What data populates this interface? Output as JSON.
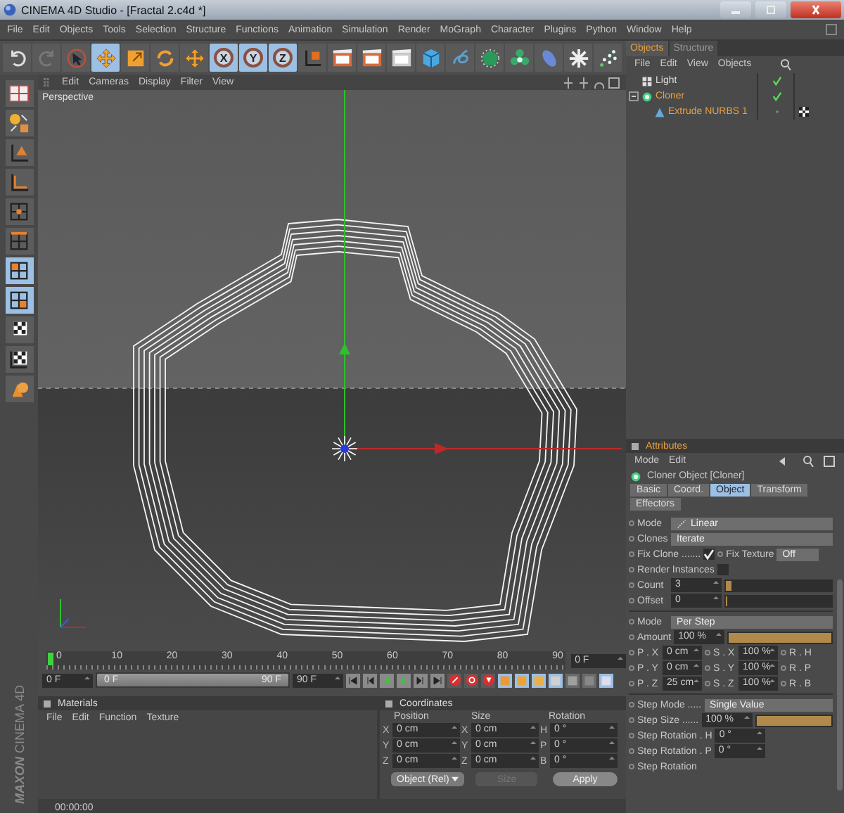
{
  "window": {
    "title": "CINEMA 4D Studio - [Fractal 2.c4d *]"
  },
  "menu": [
    "File",
    "Edit",
    "Objects",
    "Tools",
    "Selection",
    "Structure",
    "Functions",
    "Animation",
    "Simulation",
    "Render",
    "MoGraph",
    "Character",
    "Plugins",
    "Python",
    "Window",
    "Help"
  ],
  "toolbar": [
    {
      "kind": "undo",
      "selected": false
    },
    {
      "kind": "redo",
      "selected": false
    },
    {
      "kind": "select",
      "selected": false
    },
    {
      "kind": "move",
      "selected": true
    },
    {
      "kind": "scale",
      "selected": false
    },
    {
      "kind": "rotate",
      "selected": false
    },
    {
      "kind": "add",
      "selected": false
    },
    {
      "kind": "axis",
      "label": "X",
      "selected": true
    },
    {
      "kind": "axis",
      "label": "Y",
      "selected": true
    },
    {
      "kind": "axis",
      "label": "Z",
      "selected": true
    },
    {
      "kind": "coord",
      "selected": false
    },
    {
      "kind": "render-view",
      "selected": false
    },
    {
      "kind": "render",
      "selected": false
    },
    {
      "kind": "render-settings",
      "selected": false
    },
    {
      "kind": "cube",
      "selected": false
    },
    {
      "kind": "spline",
      "selected": false
    },
    {
      "kind": "nurbs",
      "selected": false
    },
    {
      "kind": "cloner",
      "selected": false
    },
    {
      "kind": "deformer",
      "selected": false
    },
    {
      "kind": "scene",
      "selected": false
    },
    {
      "kind": "particles",
      "selected": false
    }
  ],
  "modes": [
    {
      "kind": "layout",
      "selected": false
    },
    {
      "kind": "model",
      "selected": false
    },
    {
      "kind": "object",
      "selected": false
    },
    {
      "kind": "axis",
      "selected": false
    },
    {
      "kind": "points",
      "selected": false
    },
    {
      "kind": "edges",
      "selected": false
    },
    {
      "kind": "polygons",
      "selected": true
    },
    {
      "kind": "uvw",
      "selected": true
    },
    {
      "kind": "texture",
      "selected": false
    },
    {
      "kind": "texture-axis",
      "selected": false
    },
    {
      "kind": "workplane",
      "selected": false
    }
  ],
  "viewport": {
    "menu": [
      "Edit",
      "Cameras",
      "Display",
      "Filter",
      "View"
    ],
    "label": "Perspective"
  },
  "timeline": {
    "ticks": [
      "0",
      "10",
      "20",
      "30",
      "40",
      "50",
      "60",
      "70",
      "80",
      "90"
    ],
    "level": 0,
    "current": "0 F",
    "start": "0 F",
    "range": {
      "start": "0 F",
      "end": "90 F",
      "level": 1
    },
    "end": "90 F",
    "key_tools": [
      {
        "kind": "move",
        "selected": true
      },
      {
        "kind": "scale",
        "selected": true
      },
      {
        "kind": "rotate",
        "selected": true
      },
      {
        "kind": "parameter",
        "selected": true
      },
      {
        "kind": "pla",
        "selected": false
      },
      {
        "kind": "point",
        "selected": false
      },
      {
        "kind": "scheme",
        "selected": true
      }
    ]
  },
  "materials": {
    "title": "Materials",
    "menu": [
      "File",
      "Edit",
      "Function",
      "Texture"
    ]
  },
  "coordinates": {
    "title": "Coordinates",
    "columns": [
      "Position",
      "Size",
      "Rotation"
    ],
    "rows": [
      {
        "axes": [
          "X",
          "X",
          "H"
        ],
        "values": [
          "0 cm",
          "0 cm",
          "0 °"
        ]
      },
      {
        "axes": [
          "Y",
          "Y",
          "P"
        ],
        "values": [
          "0 cm",
          "0 cm",
          "0 °"
        ]
      },
      {
        "axes": [
          "Z",
          "Z",
          "B"
        ],
        "values": [
          "0 cm",
          "0 cm",
          "0 °"
        ]
      }
    ],
    "mode": "Object (Rel)",
    "size_mode": {
      "value": "Size",
      "disabled": true
    },
    "apply": "Apply"
  },
  "status_bar": {
    "time": "00:00:00"
  },
  "logo": {
    "brand": "MAXON",
    "product": "CINEMA 4D"
  },
  "objects": {
    "tabs": [
      {
        "label": "Objects",
        "selected": true
      },
      {
        "label": "Structure",
        "selected": false
      }
    ],
    "menu": [
      "File",
      "Edit",
      "View",
      "Objects"
    ],
    "tree": [
      {
        "name": "Light",
        "kind": "light",
        "selected": false,
        "checked": true,
        "tag": false
      },
      {
        "name": "Cloner",
        "kind": "cloner",
        "selected": true,
        "checked": true,
        "tag": false,
        "expanded": true,
        "children": [
          {
            "name": "Extrude NURBS 1",
            "kind": "extrude",
            "selected": true,
            "checked": false,
            "tag": true
          }
        ]
      }
    ]
  },
  "attributes": {
    "title": "Attributes",
    "menu": [
      "Mode",
      "Edit"
    ],
    "object": "Cloner Object [Cloner]",
    "tabs": [
      {
        "label": "Basic",
        "selected": false
      },
      {
        "label": "Coord.",
        "selected": false
      },
      {
        "label": "Object",
        "selected": true
      },
      {
        "label": "Transform",
        "selected": false
      },
      {
        "label": "Effectors",
        "selected": false
      }
    ],
    "rows": [
      {
        "kind": "dropdown",
        "label": "Mode",
        "value": "Linear",
        "icon": true
      },
      {
        "kind": "dropdown",
        "label": "Clones",
        "value": "Iterate"
      },
      {
        "kind": "checks",
        "label": "Fix Clone .......",
        "checked": true,
        "label2": "Fix Texture",
        "value": "Off"
      },
      {
        "kind": "check",
        "label": "Render Instances",
        "checked": false
      },
      {
        "kind": "slider",
        "label": "Count",
        "value": "3",
        "level": 0.05
      },
      {
        "kind": "slider",
        "label": "Offset",
        "value": "0",
        "level": 0
      },
      {
        "kind": "divider"
      },
      {
        "kind": "dropdown",
        "label": "Mode",
        "value": "Per Step"
      },
      {
        "kind": "slider",
        "label": "Amount",
        "value": "100 %",
        "level": 1
      },
      {
        "kind": "triple",
        "cells": [
          {
            "label": "P . X",
            "value": "0 cm"
          },
          {
            "label": "S . X",
            "value": "100 %"
          },
          {
            "label": "R . H"
          }
        ]
      },
      {
        "kind": "triple",
        "cells": [
          {
            "label": "P . Y",
            "value": "0 cm"
          },
          {
            "label": "S . Y",
            "value": "100 %"
          },
          {
            "label": "R . P"
          }
        ]
      },
      {
        "kind": "triple",
        "cells": [
          {
            "label": "P . Z",
            "value": "25 cm"
          },
          {
            "label": "S . Z",
            "value": "100 %"
          },
          {
            "label": "R . B"
          }
        ]
      },
      {
        "kind": "divider"
      },
      {
        "kind": "dropdown",
        "label": "Step Mode .....",
        "value": "Single Value"
      },
      {
        "kind": "slider",
        "label": "Step Size ......",
        "value": "100 %",
        "level": 1
      },
      {
        "kind": "field",
        "label": "Step Rotation . H",
        "value": "0 °"
      },
      {
        "kind": "field",
        "label": "Step Rotation . P",
        "value": "0 °"
      },
      {
        "kind": "field",
        "label": "Step Rotation"
      }
    ]
  }
}
